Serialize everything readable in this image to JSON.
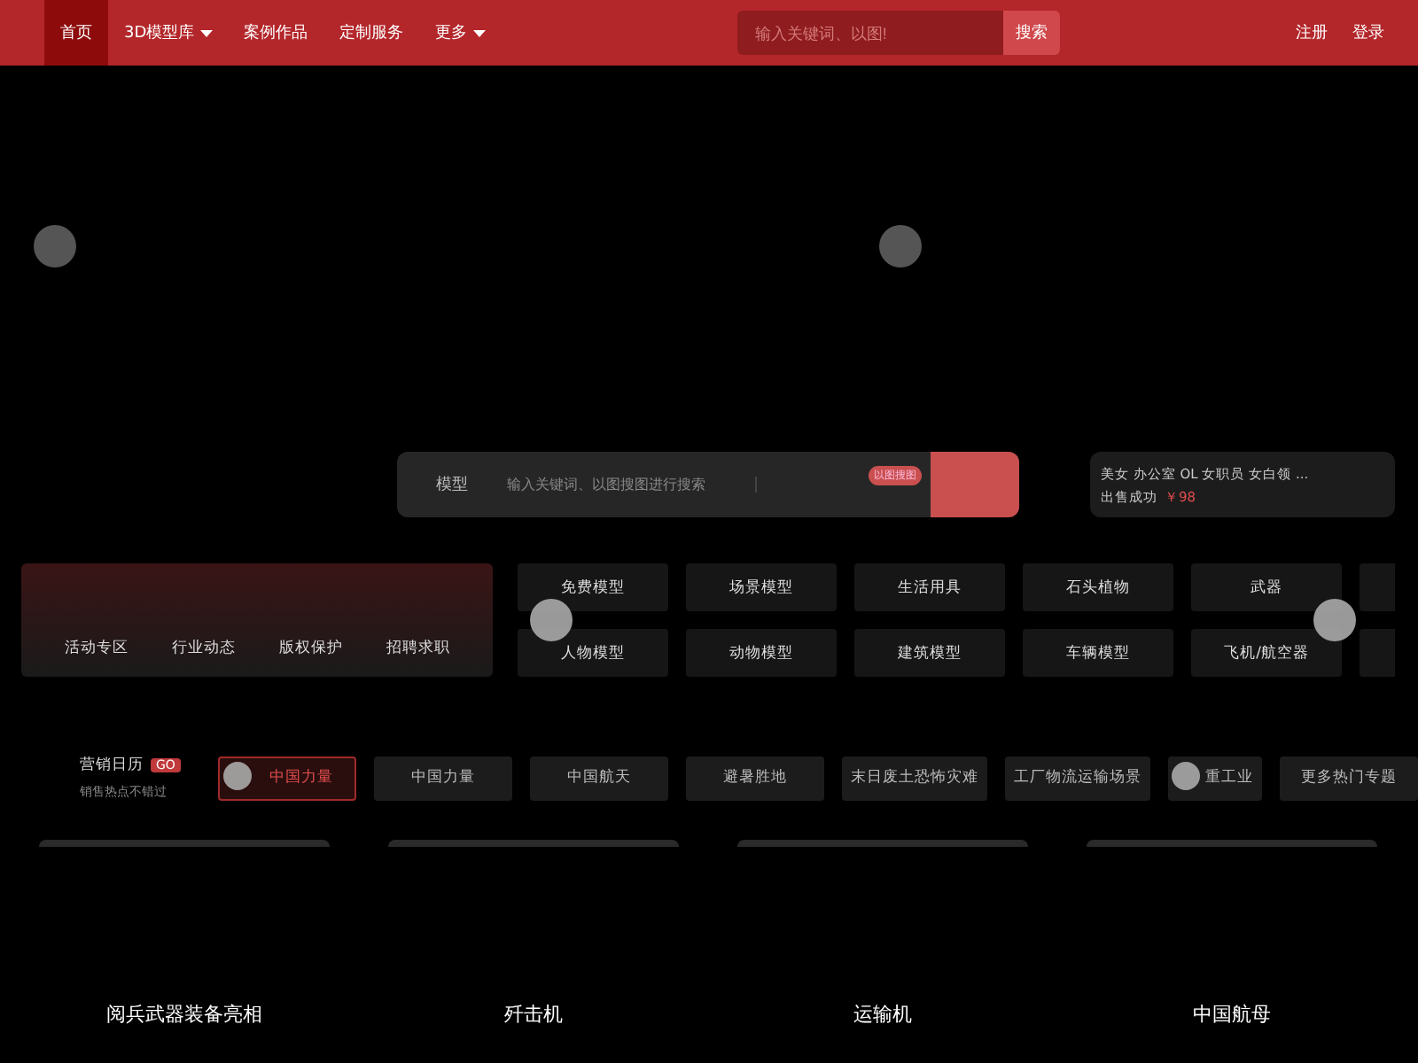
{
  "nav": {
    "items": [
      {
        "label": "首页",
        "selected": true,
        "dropdown": false
      },
      {
        "label": "3D模型库",
        "selected": false,
        "dropdown": true
      },
      {
        "label": "案例作品",
        "selected": false,
        "dropdown": false
      },
      {
        "label": "定制服务",
        "selected": false,
        "dropdown": false
      },
      {
        "label": "更多",
        "selected": false,
        "dropdown": true
      }
    ],
    "search": {
      "placeholder": "输入关键词、以图!",
      "button": "搜索"
    },
    "account": [
      "注册",
      "登录"
    ]
  },
  "hero_search": {
    "category": "模型",
    "placeholder": "输入关键词、以图搜图进行搜索",
    "image_search": "以图搜图"
  },
  "sale": {
    "title": "美女 办公室 OL 女职员 女白领 ...",
    "status": "出售成功",
    "price": "￥98"
  },
  "links": [
    "活动专区",
    "行业动态",
    "版权保护",
    "招聘求职"
  ],
  "categories": [
    "免费模型",
    "场景模型",
    "生活用具",
    "石头植物",
    "武器",
    "人物模型",
    "动物模型",
    "建筑模型",
    "车辆模型",
    "飞机/航空器"
  ],
  "calendar": {
    "title": "营销日历",
    "badge": "GO",
    "subtitle": "销售热点不错过"
  },
  "topics": [
    {
      "label": "中国力量",
      "selected": true
    },
    {
      "label": "中国力量",
      "selected": false
    },
    {
      "label": "中国航天",
      "selected": false
    },
    {
      "label": "避暑胜地",
      "selected": false
    },
    {
      "label": "末日废土恐怖灾难",
      "selected": false
    },
    {
      "label": "工厂物流运输场景",
      "selected": false
    },
    {
      "label": "重工业",
      "selected": false
    },
    {
      "label": "更多热门专题",
      "selected": false
    }
  ],
  "showcase": [
    "阅兵武器装备亮相",
    "歼击机",
    "运输机",
    "中国航母"
  ]
}
